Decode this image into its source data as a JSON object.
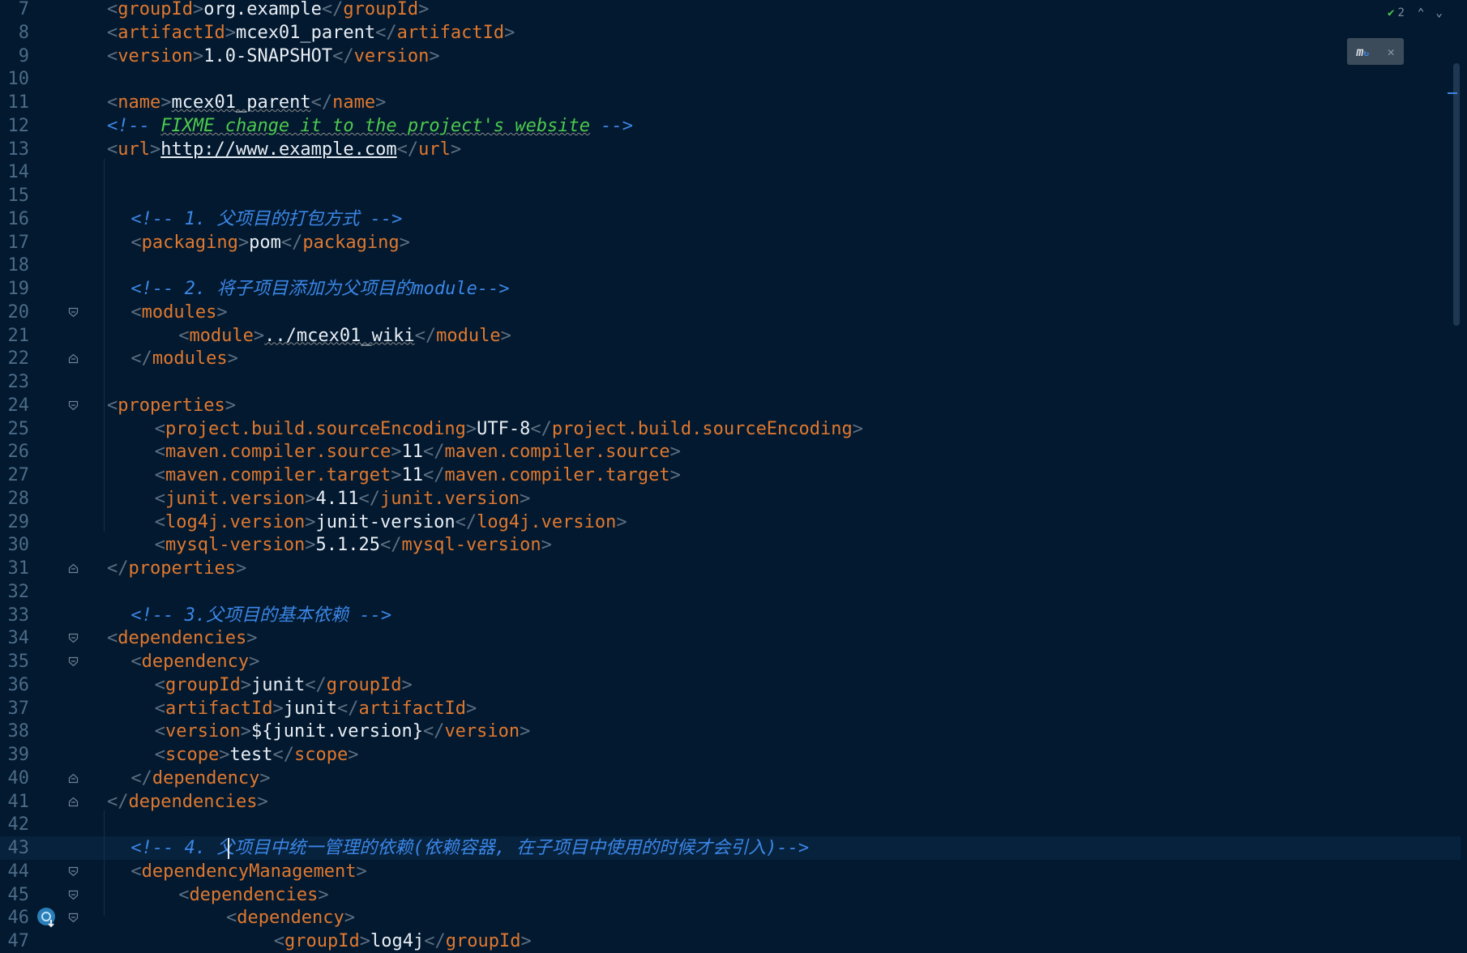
{
  "editor": {
    "lines": [
      {
        "num": "7",
        "indent": 0,
        "tag": "groupId",
        "text": "org.example"
      },
      {
        "num": "8",
        "indent": 0,
        "tag": "artifactId",
        "text": "mcex01_parent"
      },
      {
        "num": "9",
        "indent": 0,
        "tag": "version",
        "text": "1.0-SNAPSHOT"
      },
      {
        "num": "10"
      },
      {
        "num": "11",
        "indent": 0,
        "tag": "name",
        "text": "mcex01_parent",
        "squiggle": true
      },
      {
        "num": "12",
        "indent": 0,
        "comment": "FIXME change it to the project's website",
        "fixme": true
      },
      {
        "num": "13",
        "indent": 0,
        "tag": "url",
        "text": "http://www.example.com",
        "link": true
      },
      {
        "num": "14"
      },
      {
        "num": "15"
      },
      {
        "num": "16",
        "indent": 1,
        "comment": "1. 父项目的打包方式"
      },
      {
        "num": "17",
        "indent": 1,
        "tag": "packaging",
        "text": "pom"
      },
      {
        "num": "18"
      },
      {
        "num": "19",
        "indent": 1,
        "comment": "2. 将子项目添加为父项目的module",
        "tight": true
      },
      {
        "num": "20",
        "indent": 1,
        "open": "modules",
        "fold": "open"
      },
      {
        "num": "21",
        "indent": 3,
        "tag": "module",
        "text": "../mcex01_wiki",
        "squiggle": true
      },
      {
        "num": "22",
        "indent": 1,
        "close": "modules",
        "fold": "close"
      },
      {
        "num": "23"
      },
      {
        "num": "24",
        "indent": 0,
        "open": "properties",
        "fold": "open"
      },
      {
        "num": "25",
        "indent": 2,
        "tag": "project.build.sourceEncoding",
        "text": "UTF-8"
      },
      {
        "num": "26",
        "indent": 2,
        "tag": "maven.compiler.source",
        "text": "11"
      },
      {
        "num": "27",
        "indent": 2,
        "tag": "maven.compiler.target",
        "text": "11"
      },
      {
        "num": "28",
        "indent": 2,
        "tag": "junit.version",
        "text": "4.11"
      },
      {
        "num": "29",
        "indent": 2,
        "tag": "log4j.version",
        "text": "junit-version"
      },
      {
        "num": "30",
        "indent": 2,
        "tag": "mysql-version",
        "text": "5.1.25"
      },
      {
        "num": "31",
        "indent": 0,
        "close": "properties",
        "fold": "close"
      },
      {
        "num": "32"
      },
      {
        "num": "33",
        "indent": 1,
        "comment": "3.父项目的基本依赖"
      },
      {
        "num": "34",
        "indent": 0,
        "open": "dependencies",
        "fold": "open"
      },
      {
        "num": "35",
        "indent": 1,
        "open": "dependency",
        "fold": "open"
      },
      {
        "num": "36",
        "indent": 2,
        "tag": "groupId",
        "text": "junit"
      },
      {
        "num": "37",
        "indent": 2,
        "tag": "artifactId",
        "text": "junit"
      },
      {
        "num": "38",
        "indent": 2,
        "tag": "version",
        "text": "${junit.version}"
      },
      {
        "num": "39",
        "indent": 2,
        "tag": "scope",
        "text": "test"
      },
      {
        "num": "40",
        "indent": 1,
        "close": "dependency",
        "fold": "close"
      },
      {
        "num": "41",
        "indent": 0,
        "close": "dependencies",
        "fold": "close"
      },
      {
        "num": "42"
      },
      {
        "num": "43",
        "indent": 1,
        "comment": "4. 父项目中统一管理的依赖(依赖容器, 在子项目中使用的时候才会引入)",
        "tight": true,
        "current": true
      },
      {
        "num": "44",
        "indent": 1,
        "open": "dependencyManagement",
        "fold": "open"
      },
      {
        "num": "45",
        "indent": 3,
        "open": "dependencies",
        "fold": "open"
      },
      {
        "num": "46",
        "indent": 5,
        "open": "dependency",
        "fold": "open",
        "bulb": true
      },
      {
        "num": "47",
        "indent": 7,
        "tag": "groupId",
        "text": "log4j"
      }
    ]
  },
  "inspection": {
    "count": "2",
    "icon": "check-warning-icon"
  },
  "maven_popup": {
    "icon": "maven-reload-icon"
  },
  "colors": {
    "background": "#02192f",
    "tag": "#e0782f",
    "bracket": "#5d6f82",
    "text": "#e9eef5",
    "comment": "#3c86e6",
    "fixme": "#4ec94e",
    "line_number": "#4d6b87"
  }
}
